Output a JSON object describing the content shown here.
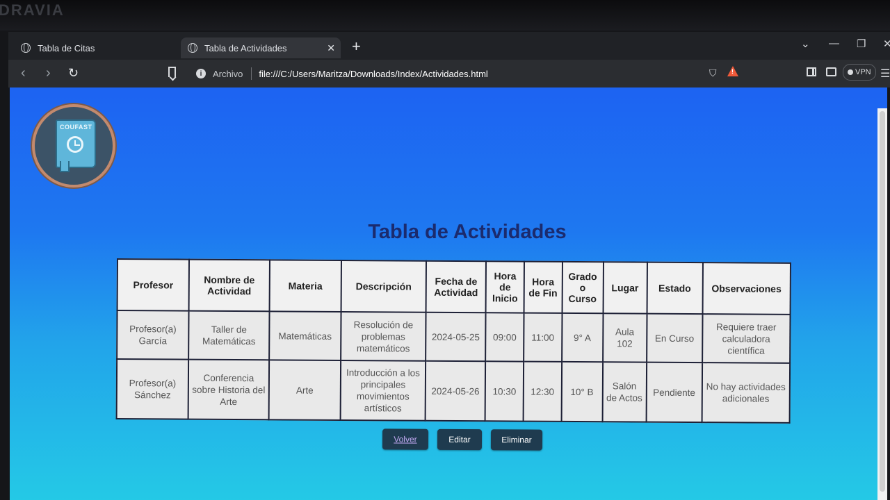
{
  "watermark": "DRAVIA",
  "browser": {
    "tabs": [
      {
        "title": "Tabla de Citas",
        "active": false
      },
      {
        "title": "Tabla de Actividades",
        "active": true
      }
    ],
    "address": {
      "scheme_label": "Archivo",
      "url": "file:///C:/Users/Maritza/Downloads/Index/Actividades.html"
    },
    "vpn_label": "VPN"
  },
  "page": {
    "logo_text": "COUFAST",
    "title": "Tabla de Actividades",
    "table": {
      "headers": [
        "Profesor",
        "Nombre de Actividad",
        "Materia",
        "Descripción",
        "Fecha de Actividad",
        "Hora de Inicio",
        "Hora de Fin",
        "Grado o Curso",
        "Lugar",
        "Estado",
        "Observaciones"
      ],
      "rows": [
        [
          "Profesor(a) García",
          "Taller de Matemáticas",
          "Matemáticas",
          "Resolución de problemas matemáticos",
          "2024-05-25",
          "09:00",
          "11:00",
          "9° A",
          "Aula 102",
          "En Curso",
          "Requiere traer calculadora científica"
        ],
        [
          "Profesor(a) Sánchez",
          "Conferencia sobre Historia del Arte",
          "Arte",
          "Introducción a los principales movimientos artísticos",
          "2024-05-26",
          "10:30",
          "12:30",
          "10° B",
          "Salón de Actos",
          "Pendiente",
          "No hay actividades adicionales"
        ]
      ]
    },
    "buttons": {
      "volver": "Volver",
      "editar": "Editar",
      "eliminar": "Eliminar"
    }
  }
}
